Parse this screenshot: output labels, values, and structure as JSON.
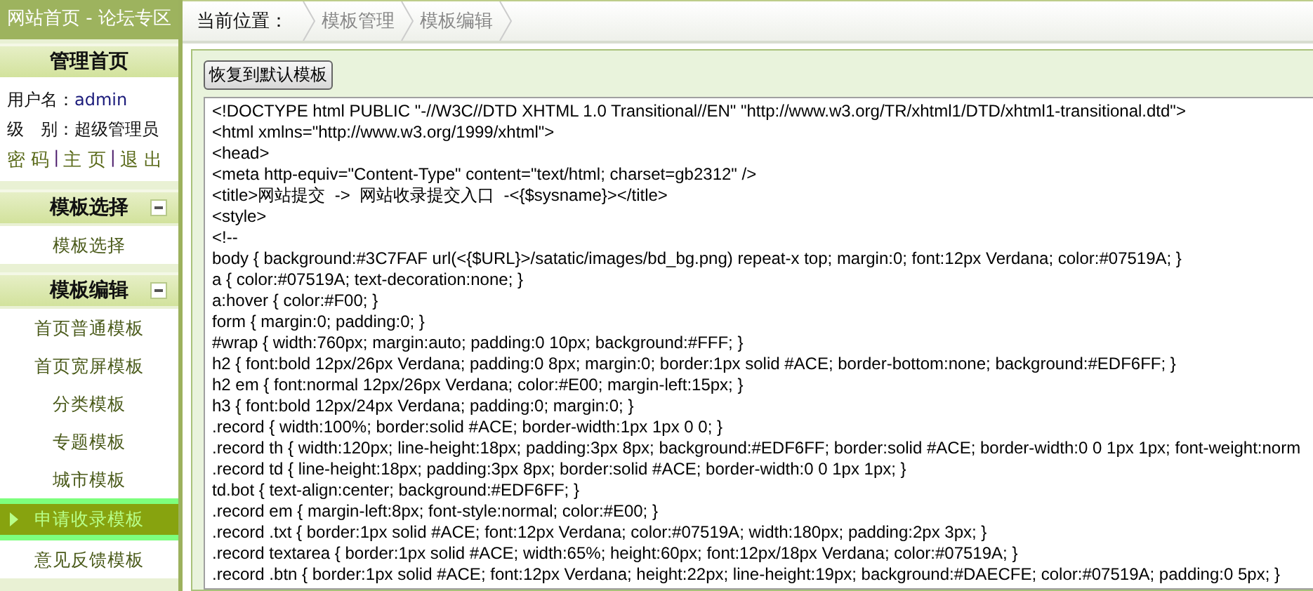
{
  "header": {
    "title": "网站首页 - 论坛专区"
  },
  "sidebar": {
    "home": {
      "title": "管理首页"
    },
    "user": {
      "name_label": "用户名：",
      "name": "admin",
      "level_label": "级　别：",
      "level": "超级管理员",
      "link_row": [
        {
          "kind": "link",
          "text": "密 码"
        },
        {
          "kind": "separator",
          "text": "|"
        },
        {
          "kind": "link",
          "text": "主 页"
        },
        {
          "kind": "separator",
          "text": "|"
        },
        {
          "kind": "link",
          "text": "退 出"
        }
      ]
    },
    "sections": [
      {
        "title": "模板选择",
        "expanded": true,
        "items": [
          {
            "label": "模板选择",
            "selected": false
          }
        ]
      },
      {
        "title": "模板编辑",
        "expanded": true,
        "items": [
          {
            "label": "首页普通模板",
            "selected": false
          },
          {
            "label": "首页宽屏模板",
            "selected": false
          },
          {
            "label": "分类模板",
            "selected": false
          },
          {
            "label": "专题模板",
            "selected": false
          },
          {
            "label": "城市模板",
            "selected": false
          },
          {
            "label": "申请收录模板",
            "selected": true
          },
          {
            "label": "意见反馈模板",
            "selected": false
          }
        ]
      }
    ]
  },
  "breadcrumb": {
    "label": "当前位置：",
    "items": [
      "模板管理",
      "模板编辑"
    ]
  },
  "restore_button": "恢复到默认模板",
  "code_lines": [
    "<!DOCTYPE html PUBLIC \"-//W3C//DTD XHTML 1.0 Transitional//EN\" \"http://www.w3.org/TR/xhtml1/DTD/xhtml1-transitional.dtd\">",
    "<html xmlns=\"http://www.w3.org/1999/xhtml\">",
    "<head>",
    "<meta http-equiv=\"Content-Type\" content=\"text/html; charset=gb2312\" />",
    "<title>网站提交  ->  网站收录提交入口  -<{$sysname}></title>",
    "<style>",
    "<!--",
    "body { background:#3C7FAF url(<{$URL}>/satatic/images/bd_bg.png) repeat-x top; margin:0; font:12px Verdana; color:#07519A; }",
    "a { color:#07519A; text-decoration:none; }",
    "a:hover { color:#F00; }",
    "form { margin:0; padding:0; }",
    "#wrap { width:760px; margin:auto; padding:0 10px; background:#FFF; }",
    "h2 { font:bold 12px/26px Verdana; padding:0 8px; margin:0; border:1px solid #ACE; border-bottom:none; background:#EDF6FF; }",
    "h2 em { font:normal 12px/26px Verdana; color:#E00; margin-left:15px; }",
    "h3 { font:bold 12px/24px Verdana; padding:0; margin:0; }",
    ".record { width:100%; border:solid #ACE; border-width:1px 1px 0 0; }",
    ".record th { width:120px; line-height:18px; padding:3px 8px; background:#EDF6FF; border:solid #ACE; border-width:0 0 1px 1px; font-weight:norm",
    ".record td { line-height:18px; padding:3px 8px; border:solid #ACE; border-width:0 0 1px 1px; }",
    "td.bot { text-align:center; background:#EDF6FF; }",
    ".record em { margin-left:8px; font-style:normal; color:#E00; }",
    ".record .txt { border:1px solid #ACE; font:12px Verdana; color:#07519A; width:180px; padding:2px 3px; }",
    ".record textarea { border:1px solid #ACE; width:65%; height:60px; font:12px/18px Verdana; color:#07519A; }",
    ".record .btn { border:1px solid #ACE; font:12px Verdana; height:22px; line-height:19px; background:#DAECFE; color:#07519A; padding:0 5px; }"
  ]
}
